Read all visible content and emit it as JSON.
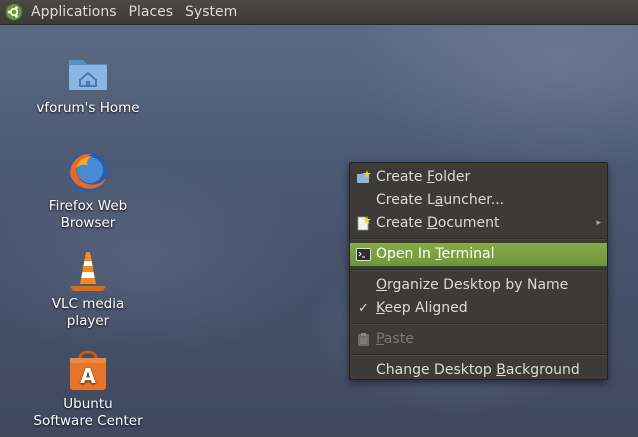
{
  "panel": {
    "menus": [
      "Applications",
      "Places",
      "System"
    ]
  },
  "desktop": {
    "icons": [
      {
        "label": "vforum's Home",
        "icon": "home-folder-icon"
      },
      {
        "label": "Firefox Web Browser",
        "icon": "firefox-icon"
      },
      {
        "label": "VLC media player",
        "icon": "vlc-icon"
      },
      {
        "label": "Ubuntu Software Center",
        "icon": "software-center-icon"
      }
    ]
  },
  "context_menu": {
    "items": [
      {
        "pre": "Create ",
        "mn": "F",
        "post": "older",
        "icon": "new-folder-icon"
      },
      {
        "pre": "Create L",
        "mn": "a",
        "post": "uncher...",
        "icon": ""
      },
      {
        "pre": "Create ",
        "mn": "D",
        "post": "ocument",
        "icon": "new-document-icon",
        "submenu": true
      },
      {
        "pre": "Open In ",
        "mn": "T",
        "post": "erminal",
        "icon": "terminal-icon",
        "highlighted": true
      },
      {
        "pre": "",
        "mn": "O",
        "post": "rganize Desktop by Name",
        "icon": ""
      },
      {
        "pre": "",
        "mn": "K",
        "post": "eep Aligned",
        "icon": "checkmark-icon",
        "checked": true
      },
      {
        "pre": "",
        "mn": "P",
        "post": "aste",
        "icon": "paste-icon",
        "disabled": true
      },
      {
        "pre": "Change Desktop ",
        "mn": "B",
        "post": "ackground",
        "icon": ""
      }
    ]
  },
  "colors": {
    "highlight": "#7aa042",
    "menu_bg": "#3c3b37",
    "panel_bg": "#3e3d39"
  }
}
